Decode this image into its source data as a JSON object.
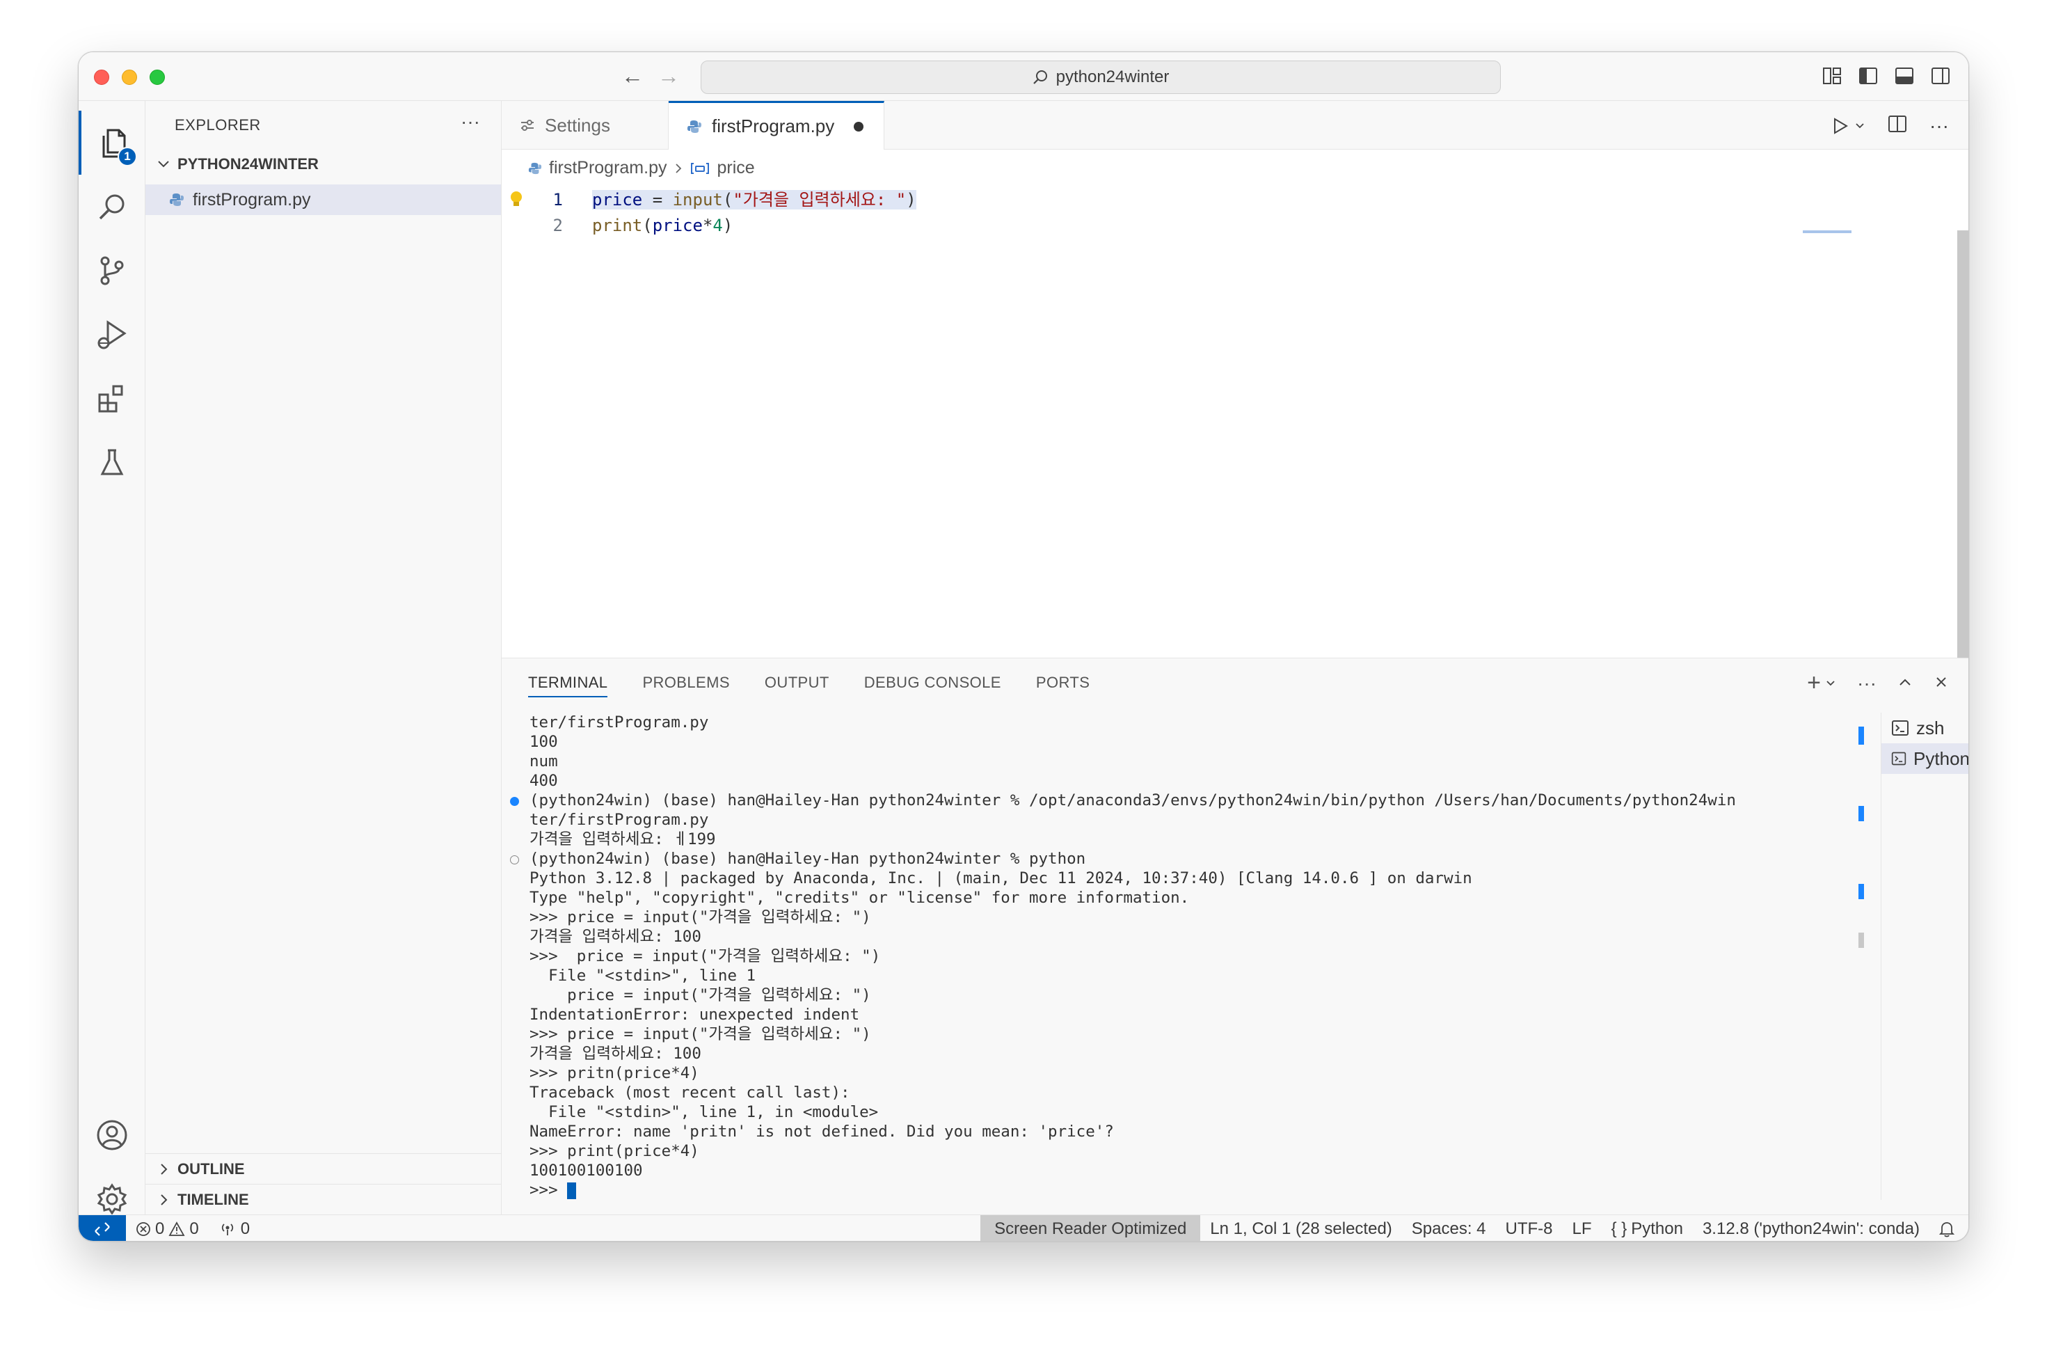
{
  "window": {
    "title": "python24winter"
  },
  "explorer": {
    "header": "EXPLORER",
    "more": "···",
    "badge": "1",
    "folder": "PYTHON24WINTER",
    "files": [
      "firstProgram.py"
    ],
    "sections": [
      "OUTLINE",
      "TIMELINE"
    ]
  },
  "tabs": [
    {
      "label": "Settings"
    },
    {
      "label": "firstProgram.py",
      "dirty": true
    }
  ],
  "breadcrumb": {
    "file": "firstProgram.py",
    "symbol": "price"
  },
  "code": {
    "line_numbers": [
      "1",
      "2"
    ],
    "line1": {
      "var": "price",
      "eq": " = ",
      "fn": "input",
      "open": "(",
      "str": "\"가격을 입력하세요: \"",
      "close": ")"
    },
    "line2": {
      "fn": "print",
      "open": "(",
      "var": "price",
      "op": "*",
      "num": "4",
      "close": ")"
    }
  },
  "panel": {
    "tabs": [
      "TERMINAL",
      "PROBLEMS",
      "OUTPUT",
      "DEBUG CONSOLE",
      "PORTS"
    ],
    "actions": {
      "add": "+",
      "more": "···"
    },
    "terminals": [
      "zsh",
      "Python"
    ],
    "lines": [
      "ter/firstProgram.py",
      "100",
      "num",
      "400",
      "(python24win) (base) han@Hailey-Han python24winter % /opt/anaconda3/envs/python24win/bin/python /Users/han/Documents/python24win",
      "ter/firstProgram.py",
      "가격을 입력하세요: ㅔ199",
      "(python24win) (base) han@Hailey-Han python24winter % python",
      "Python 3.12.8 | packaged by Anaconda, Inc. | (main, Dec 11 2024, 10:37:40) [Clang 14.0.6 ] on darwin",
      "Type \"help\", \"copyright\", \"credits\" or \"license\" for more information.",
      ">>> price = input(\"가격을 입력하세요: \")",
      "가격을 입력하세요: 100",
      ">>>  price = input(\"가격을 입력하세요: \")",
      "  File \"<stdin>\", line 1",
      "    price = input(\"가격을 입력하세요: \")",
      "IndentationError: unexpected indent",
      ">>> price = input(\"가격을 입력하세요: \")",
      "가격을 입력하세요: 100",
      ">>> pritn(price*4)",
      "Traceback (most recent call last):",
      "  File \"<stdin>\", line 1, in <module>",
      "NameError: name 'pritn' is not defined. Did you mean: 'price'?",
      ">>> print(price*4)",
      "100100100100",
      ">>> "
    ]
  },
  "status": {
    "errors": "0",
    "warnings": "0",
    "ports": "0",
    "screen_reader": "Screen Reader Optimized",
    "position": "Ln 1, Col 1 (28 selected)",
    "spaces": "Spaces: 4",
    "encoding": "UTF-8",
    "eol": "LF",
    "language_icon": "{ }",
    "language": "Python",
    "interpreter": "3.12.8 ('python24win': conda)"
  },
  "colors": {
    "accent": "#005fb8",
    "string": "#a31515",
    "function": "#795e26",
    "variable": "#001080",
    "number": "#098658"
  }
}
